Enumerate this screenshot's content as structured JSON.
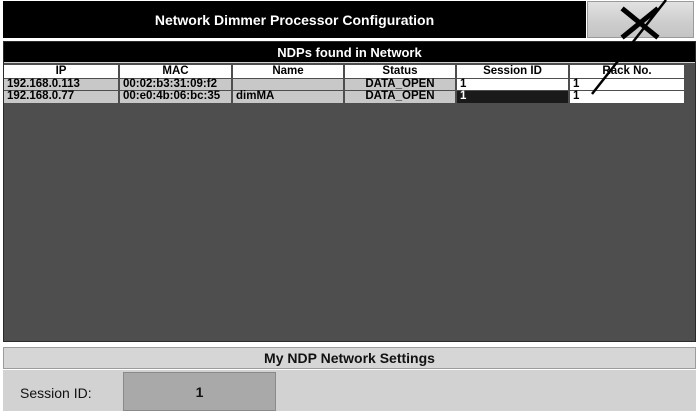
{
  "window": {
    "title": "Network Dimmer Processor Configuration",
    "close_icon": "close-x-icon"
  },
  "table": {
    "title": "NDPs found in Network",
    "columns": [
      "IP",
      "MAC",
      "Name",
      "Status",
      "Session ID",
      "Rack No."
    ],
    "rows": [
      [
        "192.168.0.113",
        "00:02:b3:31:09:f2",
        "",
        "DATA_OPEN",
        "1",
        "1"
      ],
      [
        "192.168.0.77",
        "00:e0:4b:06:bc:35",
        "dimMA",
        "DATA_OPEN",
        "1",
        "1"
      ]
    ]
  },
  "settings": {
    "title": "My NDP Network Settings",
    "session_label": "Session ID:",
    "session_value": "1"
  },
  "colors": {
    "titlebar_bg": "#000000",
    "panel_bg": "#4e4e4e",
    "cell_bg": "#c8c8c8",
    "selected_cell_bg": "#1a1a1a"
  }
}
